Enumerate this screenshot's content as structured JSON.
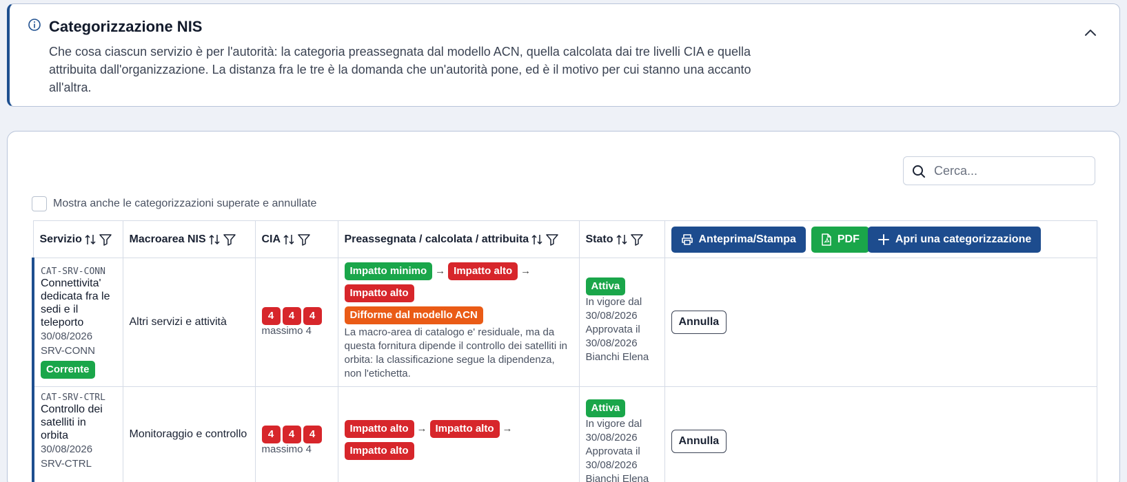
{
  "info": {
    "title": "Categorizzazione NIS",
    "description": "Che cosa ciascun servizio è per l'autorità: la categoria preassegnata dal modello ACN, quella calcolata dai tre livelli CIA e quella attribuita dall'organizzazione. La distanza fra le tre è la domanda che un'autorità pone, ed è il motivo per cui stanno una accanto all'altra."
  },
  "search": {
    "placeholder": "Cerca..."
  },
  "show_all": {
    "label": "Mostra anche le categorizzazioni superate e annullate",
    "checked": false
  },
  "columns": {
    "servizio": "Servizio",
    "macroarea": "Macroarea NIS",
    "cia": "CIA",
    "preassegnata": "Preassegnata / calcolata / attribuita",
    "stato": "Stato"
  },
  "actions": {
    "print": "Anteprima/Stampa",
    "pdf": "PDF",
    "new": "Apri una categorizzazione"
  },
  "rows": [
    {
      "code": "CAT-SRV-CONN",
      "name": "Connettivita' dedicata fra le sedi e il teleporto",
      "date": "30/08/2026",
      "service_code": "SRV-CONN",
      "tag": "Corrente",
      "macroarea": "Altri servizi e attività",
      "cia": [
        "4",
        "4",
        "4"
      ],
      "cia_max": "massimo 4",
      "preassegnata": "Impatto minimo",
      "calcolata": "Impatto alto",
      "attribuita": "Impatto alto",
      "warning": "Difforme dal modello ACN",
      "note": "La macro-area di catalogo e' residuale, ma da questa fornitura dipende il controllo dei satelliti in orbita: la classificazione segue la dipendenza, non l'etichetta.",
      "state": "Attiva",
      "state_lines": [
        "In vigore dal",
        "30/08/2026",
        "Approvata il",
        "30/08/2026",
        "Bianchi Elena"
      ],
      "action": "Annulla"
    },
    {
      "code": "CAT-SRV-CTRL",
      "name": "Controllo dei satelliti in orbita",
      "date": "30/08/2026",
      "service_code": "SRV-CTRL",
      "macroarea": "Monitoraggio e controllo",
      "cia": [
        "4",
        "4",
        "4"
      ],
      "cia_max": "massimo 4",
      "preassegnata": "Impatto alto",
      "calcolata": "Impatto alto",
      "attribuita": "Impatto alto",
      "state": "Attiva",
      "state_lines": [
        "In vigore dal",
        "30/08/2026",
        "Approvata il",
        "30/08/2026",
        "Bianchi Elena"
      ],
      "action": "Annulla"
    }
  ],
  "colors": {
    "primary": "#1d4c8e",
    "success": "#1aa64a",
    "danger": "#d7262b",
    "warning": "#ea5b16"
  }
}
